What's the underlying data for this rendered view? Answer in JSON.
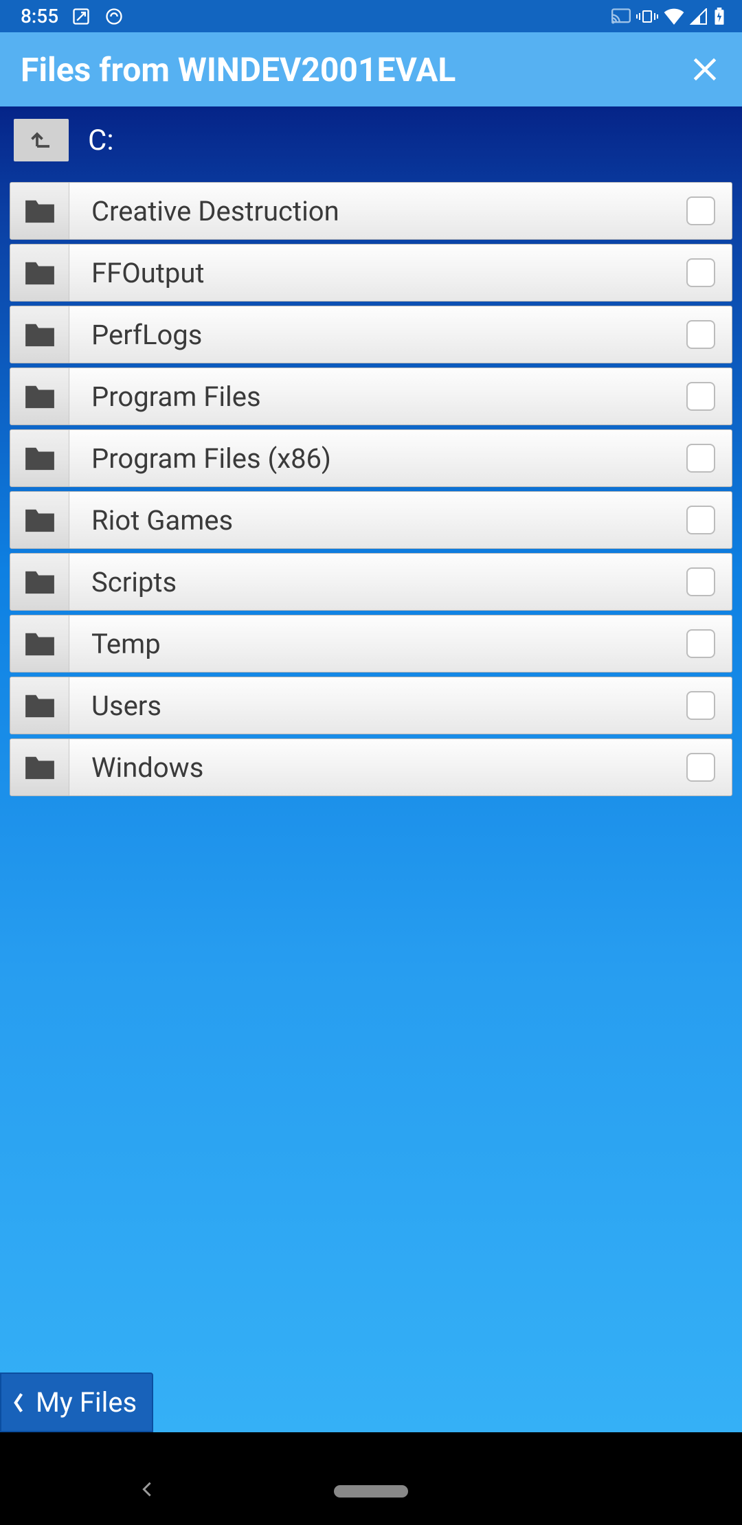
{
  "statusbar": {
    "time": "8:55"
  },
  "header": {
    "title": "Files from WINDEV2001EVAL"
  },
  "breadcrumb": {
    "label": "C:"
  },
  "folders": [
    {
      "name": "Creative Destruction"
    },
    {
      "name": "FFOutput"
    },
    {
      "name": "PerfLogs"
    },
    {
      "name": "Program Files"
    },
    {
      "name": "Program Files (x86)"
    },
    {
      "name": "Riot Games"
    },
    {
      "name": "Scripts"
    },
    {
      "name": "Temp"
    },
    {
      "name": "Users"
    },
    {
      "name": "Windows"
    }
  ],
  "footer": {
    "myFilesLabel": "My Files"
  }
}
